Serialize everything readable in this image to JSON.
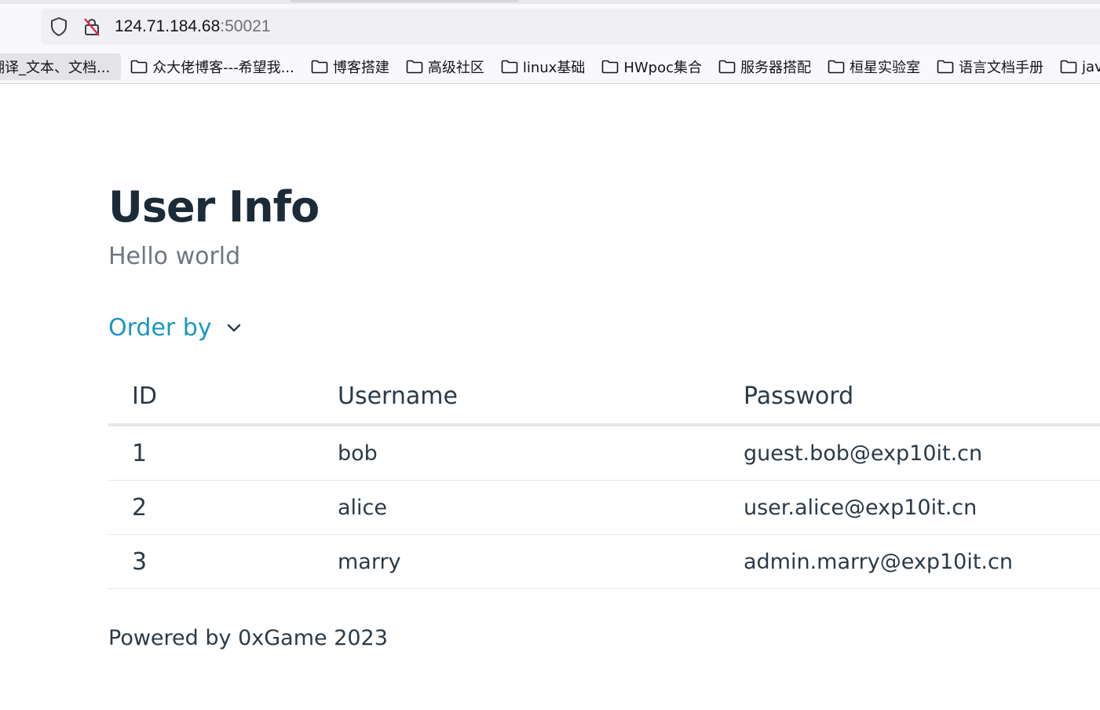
{
  "browser": {
    "url_host": "124.71.184.68",
    "url_port": ":50021",
    "bookmarks": [
      {
        "label": "翻译_文本、文档...",
        "icon": "none",
        "active": true
      },
      {
        "label": "众大佬博客---希望我...",
        "icon": "folder-icon"
      },
      {
        "label": "博客搭建",
        "icon": "folder-icon"
      },
      {
        "label": "高级社区",
        "icon": "folder-icon"
      },
      {
        "label": "linux基础",
        "icon": "folder-icon"
      },
      {
        "label": "HWpoc集合",
        "icon": "folder-icon"
      },
      {
        "label": "服务器搭配",
        "icon": "folder-icon"
      },
      {
        "label": "桓星实验室",
        "icon": "folder-icon"
      },
      {
        "label": "语言文档手册",
        "icon": "folder-icon"
      },
      {
        "label": "jav",
        "icon": "folder-icon"
      }
    ]
  },
  "page": {
    "title": "User Info",
    "subtitle": "Hello world",
    "order_by_label": "Order by",
    "table": {
      "columns": [
        "ID",
        "Username",
        "Password"
      ],
      "rows": [
        [
          "1",
          "bob",
          "guest.bob@exp10it.cn"
        ],
        [
          "2",
          "alice",
          "user.alice@exp10it.cn"
        ],
        [
          "3",
          "marry",
          "admin.marry@exp10it.cn"
        ]
      ]
    },
    "footer": "Powered by 0xGame 2023"
  },
  "colors": {
    "title": "#1c2b38",
    "subtitle": "#6e7780",
    "link_accent": "#1a98bf",
    "text": "#2c3a47",
    "table_rule": "#e5e7ea"
  }
}
